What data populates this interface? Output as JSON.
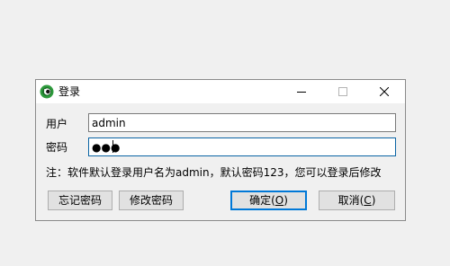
{
  "window": {
    "title": "登录",
    "icon": "app-eye-icon",
    "controls": [
      "minimize-icon",
      "maximize-icon",
      "close-icon"
    ]
  },
  "form": {
    "username_label": "用户",
    "username_value": "admin",
    "password_label": "密码",
    "password_mask": "●●●"
  },
  "note": "注：软件默认登录用户名为admin，默认密码123，您可以登录后修改",
  "buttons": {
    "forgot": "忘记密码",
    "change": "修改密码",
    "ok_pre": "确定(",
    "ok_key": "O",
    "ok_post": ")",
    "cancel_pre": "取消(",
    "cancel_key": "C",
    "cancel_post": ")"
  },
  "colors": {
    "accent": "#0078d7",
    "focus_border": "#0a64a4",
    "icon_green": "#2e9a3c"
  }
}
